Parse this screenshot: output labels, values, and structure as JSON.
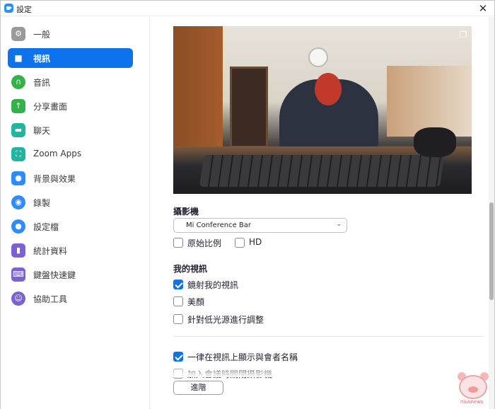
{
  "window": {
    "title": "設定",
    "close_glyph": "✕"
  },
  "sidebar": {
    "items": [
      {
        "label": "一般",
        "icon": "gear-icon",
        "color": "#9a9a9a",
        "active": false
      },
      {
        "label": "視訊",
        "icon": "video-icon",
        "color": "#0e72ed",
        "active": true
      },
      {
        "label": "音訊",
        "icon": "headphones-icon",
        "color": "#33b249",
        "active": false
      },
      {
        "label": "分享畫面",
        "icon": "share-screen-icon",
        "color": "#33b249",
        "active": false
      },
      {
        "label": "聊天",
        "icon": "chat-icon",
        "color": "#21b5a0",
        "active": false
      },
      {
        "label": "Zoom Apps",
        "icon": "apps-icon",
        "color": "#21b5a0",
        "active": false
      },
      {
        "label": "背景與效果",
        "icon": "background-icon",
        "color": "#2d8cff",
        "active": false
      },
      {
        "label": "錄製",
        "icon": "record-icon",
        "color": "#2d8cff",
        "active": false
      },
      {
        "label": "設定檔",
        "icon": "profile-icon",
        "color": "#2d8cff",
        "active": false
      },
      {
        "label": "統計資料",
        "icon": "statistics-icon",
        "color": "#7b61d1",
        "active": false
      },
      {
        "label": "鍵盤快速鍵",
        "icon": "keyboard-icon",
        "color": "#7b61d1",
        "active": false
      },
      {
        "label": "協助工具",
        "icon": "accessibility-icon",
        "color": "#7b61d1",
        "active": false
      }
    ]
  },
  "video": {
    "camera_section_title": "攝影機",
    "camera_selected": "Mi Conference Bar",
    "original_ratio_label": "原始比例",
    "original_ratio_checked": false,
    "hd_label": "HD",
    "hd_checked": false,
    "my_video_title": "我的視訊",
    "mirror_label": "鏡射我的視訊",
    "mirror_checked": true,
    "beauty_label": "美顏",
    "beauty_checked": false,
    "low_light_label": "針對低光源進行調整",
    "low_light_checked": false,
    "show_names_label": "一律在視訊上顯示與會者名稱",
    "show_names_checked": true,
    "turn_off_label": "加入會議時關閉攝影機",
    "turn_off_checked": false,
    "advanced_label": "進階"
  },
  "watermark": {
    "text": "niusnews"
  }
}
